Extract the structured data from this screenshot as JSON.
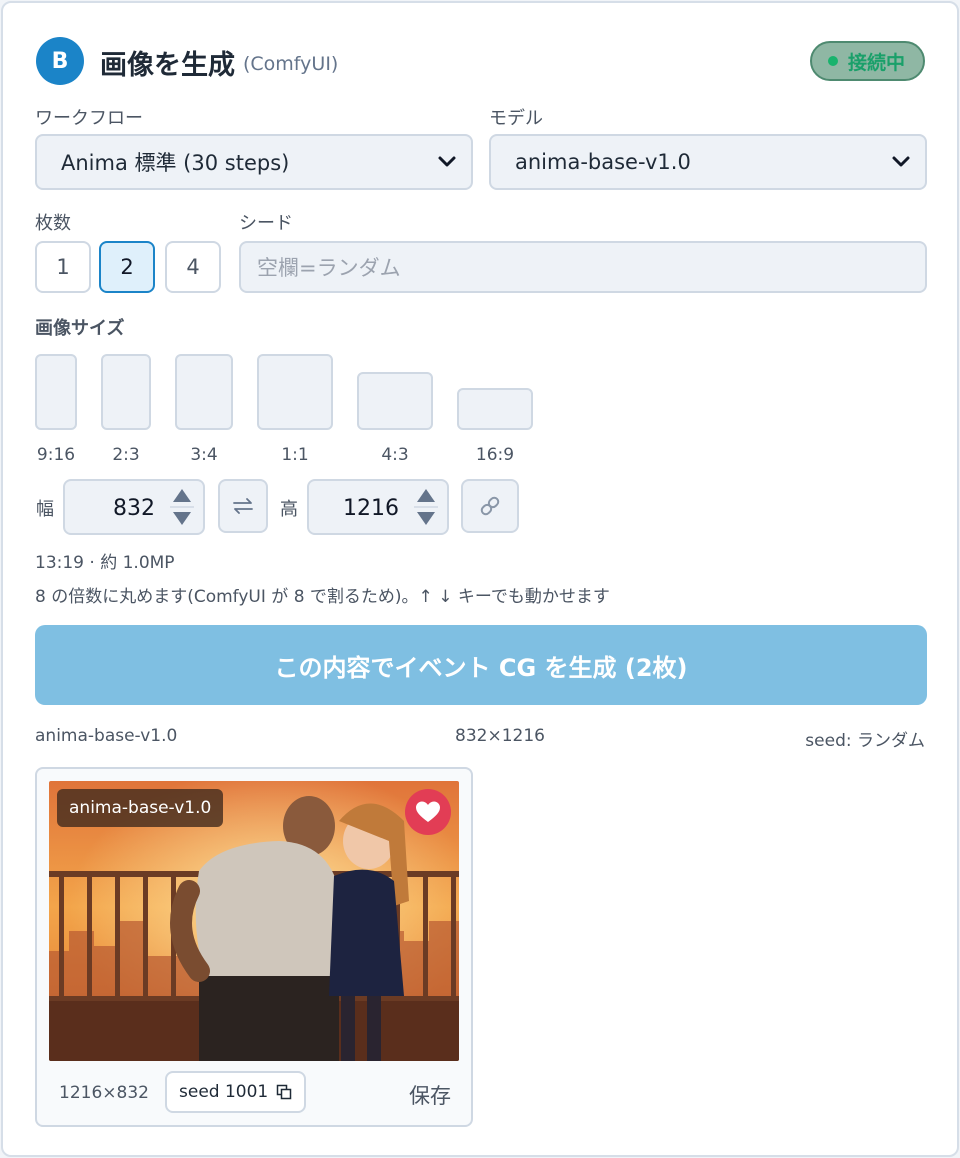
{
  "header": {
    "badge": "B",
    "title": "画像を生成",
    "subtitle": "(ComfyUI)",
    "status": "接続中"
  },
  "workflow": {
    "label": "ワークフロー",
    "value": "Anima 標準 (30 steps)"
  },
  "model": {
    "label": "モデル",
    "value": "anima-base-v1.0"
  },
  "count": {
    "label": "枚数",
    "options": [
      "1",
      "2",
      "4"
    ],
    "selected": "2"
  },
  "seed": {
    "label": "シード",
    "placeholder": "空欄=ランダム"
  },
  "size": {
    "label": "画像サイズ",
    "ratios": [
      "9:16",
      "2:3",
      "3:4",
      "1:1",
      "4:3",
      "16:9"
    ],
    "width_label": "幅",
    "width": "832",
    "height_label": "高",
    "height": "1216",
    "swap_icon": "swap-arrows-icon",
    "link_icon": "link-icon",
    "summary": "13:19 · 約 1.0MP",
    "note": "8 の倍数に丸めます(ComfyUI が 8 で割るため)。↑ ↓ キーでも動かせます"
  },
  "generate_label": "この内容でイベント CG を生成 (2枚)",
  "result_meta": {
    "model": "anima-base-v1.0",
    "dims": "832×1216",
    "seed": "seed: ランダム"
  },
  "result_card": {
    "model_tag": "anima-base-v1.0",
    "size": "1216×832",
    "seed_chip": "seed 1001",
    "save_label": "保存"
  },
  "colors": {
    "accent": "#1b84c8",
    "generate": "#7fbfe2",
    "status": "#19b36d",
    "favorite": "#e23d55"
  }
}
